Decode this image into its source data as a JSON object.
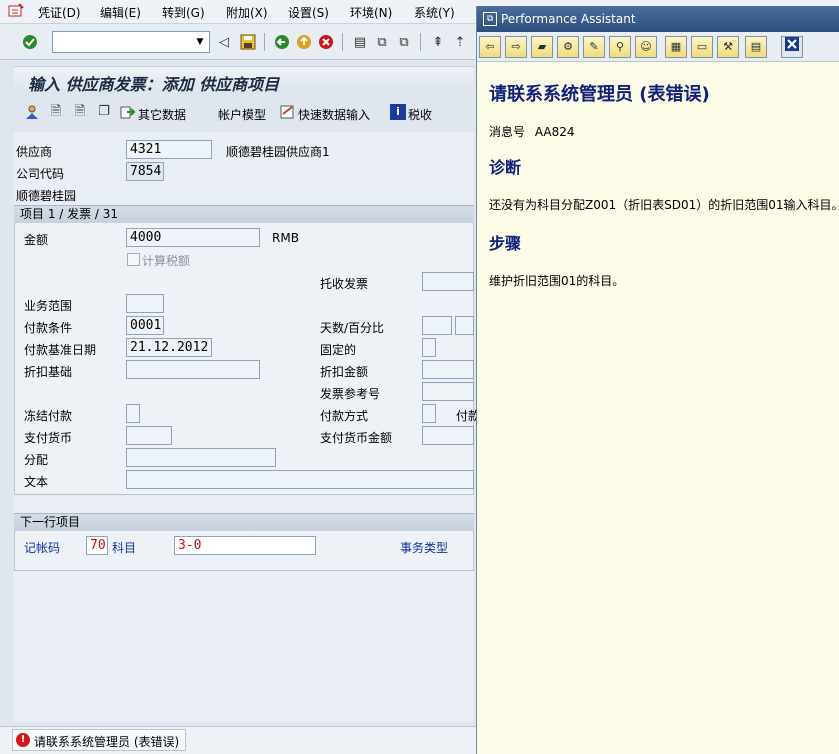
{
  "menu": {
    "items": [
      "凭证(D)",
      "编辑(E)",
      "转到(G)",
      "附加(X)",
      "设置(S)",
      "环境(N)",
      "系统(Y)"
    ]
  },
  "system_toolbar": {
    "command_field_value": ""
  },
  "screen": {
    "title": "输入 供应商发票：添加 供应商项目"
  },
  "app_toolbar": {
    "other_data": "其它数据",
    "account_model": "帐户模型",
    "fast_entry": "快速数据输入",
    "tax": "税收"
  },
  "header": {
    "vendor_label": "供应商",
    "vendor_value": "4321",
    "vendor_name": "顺德碧桂园供应商1",
    "company_code_label": "公司代码",
    "company_code_value": "7854",
    "company_name": "顺德碧桂园"
  },
  "item_section": {
    "title": "项目 1 / 发票 / 31",
    "amount_label": "金额",
    "amount_value": "4000",
    "currency": "RMB",
    "calc_tax_label": "计算税额",
    "collection_invoice_label": "托收发票",
    "business_area_label": "业务范围",
    "payment_terms_label": "付款条件",
    "payment_terms_value": "0001",
    "days_percent_label": "天数/百分比",
    "baseline_date_label": "付款基准日期",
    "baseline_date_value": "21.12.2012",
    "fixed_label": "固定的",
    "discount_base_label": "折扣基础",
    "discount_amount_label": "折扣金额",
    "invoice_ref_label": "发票参考号",
    "block_payment_label": "冻结付款",
    "payment_method_label": "付款方式",
    "payment_method_extra_label": "付款",
    "pay_currency_label": "支付货币",
    "pay_currency_amount_label": "支付货币金额",
    "assignment_label": "分配",
    "text_label": "文本"
  },
  "next_item": {
    "title": "下一行项目",
    "posting_key_label": "记帐码",
    "posting_key_value": "70",
    "account_label": "科目",
    "account_value": "3-0",
    "transaction_type_label": "事务类型"
  },
  "status_bar": {
    "message": "请联系系统管理员 (表错误)"
  },
  "performance_assistant": {
    "window_title": "Performance Assistant",
    "heading": "请联系系统管理员 (表错误)",
    "message_no_label": "消息号",
    "message_no": "AA824",
    "diagnosis_title": "诊断",
    "diagnosis_text": "还没有为科目分配Z001（折旧表SD01）的折旧范围01输入科目。",
    "procedure_title": "步骤",
    "procedure_text": "维护折旧范围01的科目。"
  },
  "colors": {
    "heading_blue": "#11217a",
    "pa_background": "#fbfbe8",
    "error_red": "#d01818"
  }
}
